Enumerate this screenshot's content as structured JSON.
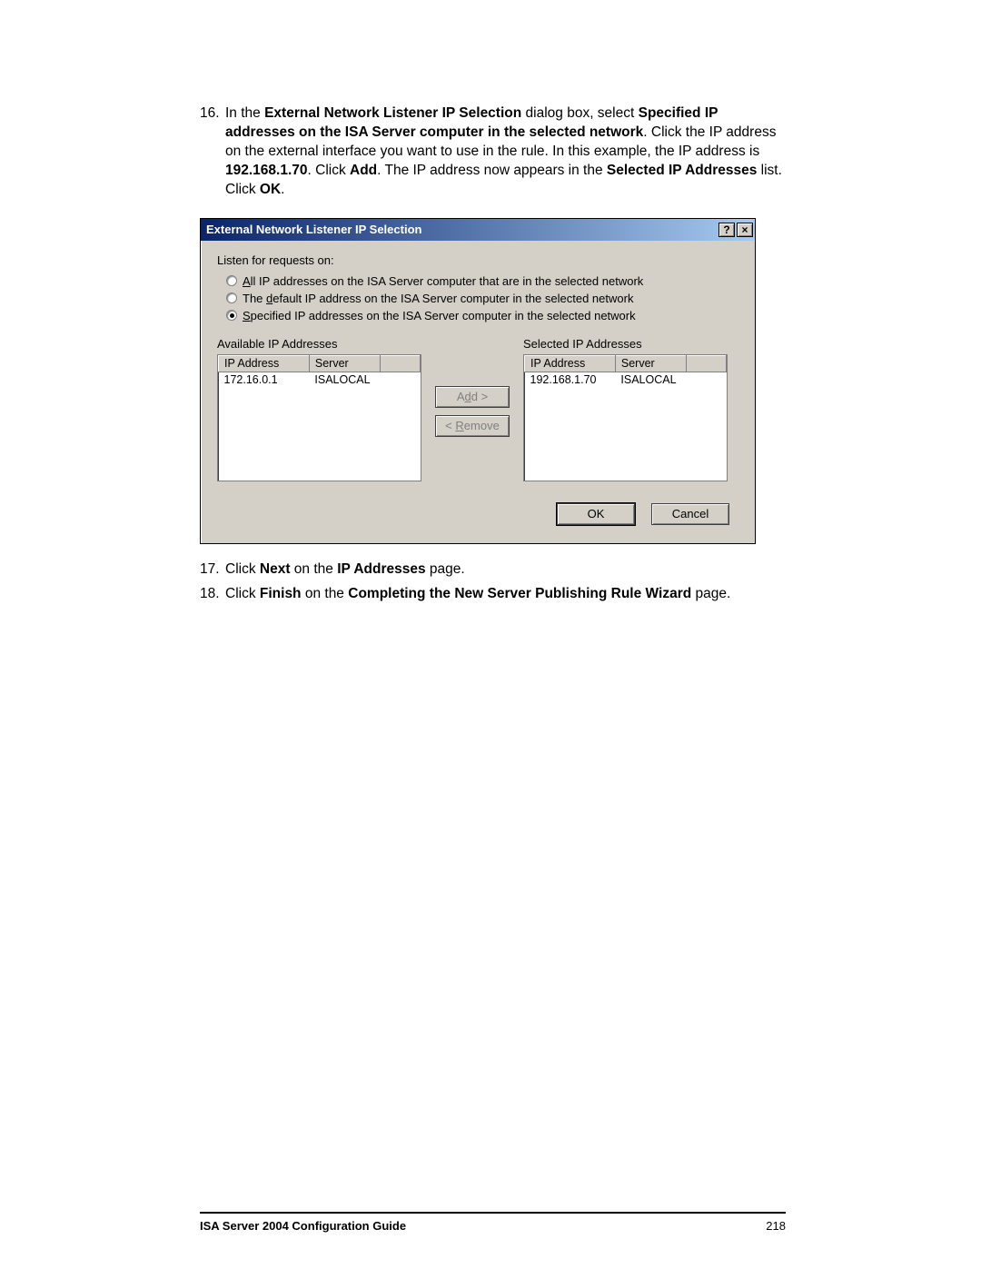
{
  "steps": {
    "s16_num": "16.",
    "s16_p1": "In the ",
    "s16_b1": "External Network Listener IP Selection",
    "s16_p2": " dialog box, select ",
    "s16_b2": "Specified IP addresses on the ISA Server computer in the selected network",
    "s16_p3": ". Click the IP address on the external interface you want to use in the rule. In this example, the IP address is ",
    "s16_b3": "192.168.1.70",
    "s16_p4": ". Click ",
    "s16_b4": "Add",
    "s16_p5": ". The IP address now appears in the ",
    "s16_b5": "Selected IP Addresses",
    "s16_p6": " list. Click ",
    "s16_b6": "OK",
    "s16_p7": ".",
    "s17_num": "17.",
    "s17_p1": "Click ",
    "s17_b1": "Next",
    "s17_p2": " on the ",
    "s17_b2": "IP Addresses",
    "s17_p3": " page.",
    "s18_num": "18.",
    "s18_p1": "Click ",
    "s18_b1": "Finish",
    "s18_p2": " on the ",
    "s18_b2": "Completing the New Server Publishing Rule Wizard",
    "s18_p3": " page."
  },
  "dialog": {
    "title": "External Network Listener IP Selection",
    "help": "?",
    "close": "×",
    "listen_label": "Listen for requests on:",
    "r1_a": "A",
    "r1_b": "ll IP addresses on the ISA Server computer that are in the selected network",
    "r2_a": "The ",
    "r2_u": "d",
    "r2_b": "efault IP address on the ISA Server computer in the selected network",
    "r3_u": "S",
    "r3_b": "pecified IP addresses on the ISA Server computer in the selected network",
    "available_label": "Available IP Addresses",
    "selected_label": "Selected IP Addresses",
    "col_ip": "IP Address",
    "col_server": "Server",
    "avail_ip": "172.16.0.1",
    "avail_srv": "ISALOCAL",
    "sel_ip": "192.168.1.70",
    "sel_srv": "ISALOCAL",
    "add_pre": "A",
    "add_u": "d",
    "add_post": "d >",
    "rem_pre": "< ",
    "rem_u": "R",
    "rem_post": "emove",
    "ok": "OK",
    "cancel": "Cancel"
  },
  "footer": {
    "title": "ISA Server 2004 Configuration Guide",
    "page": "218"
  }
}
